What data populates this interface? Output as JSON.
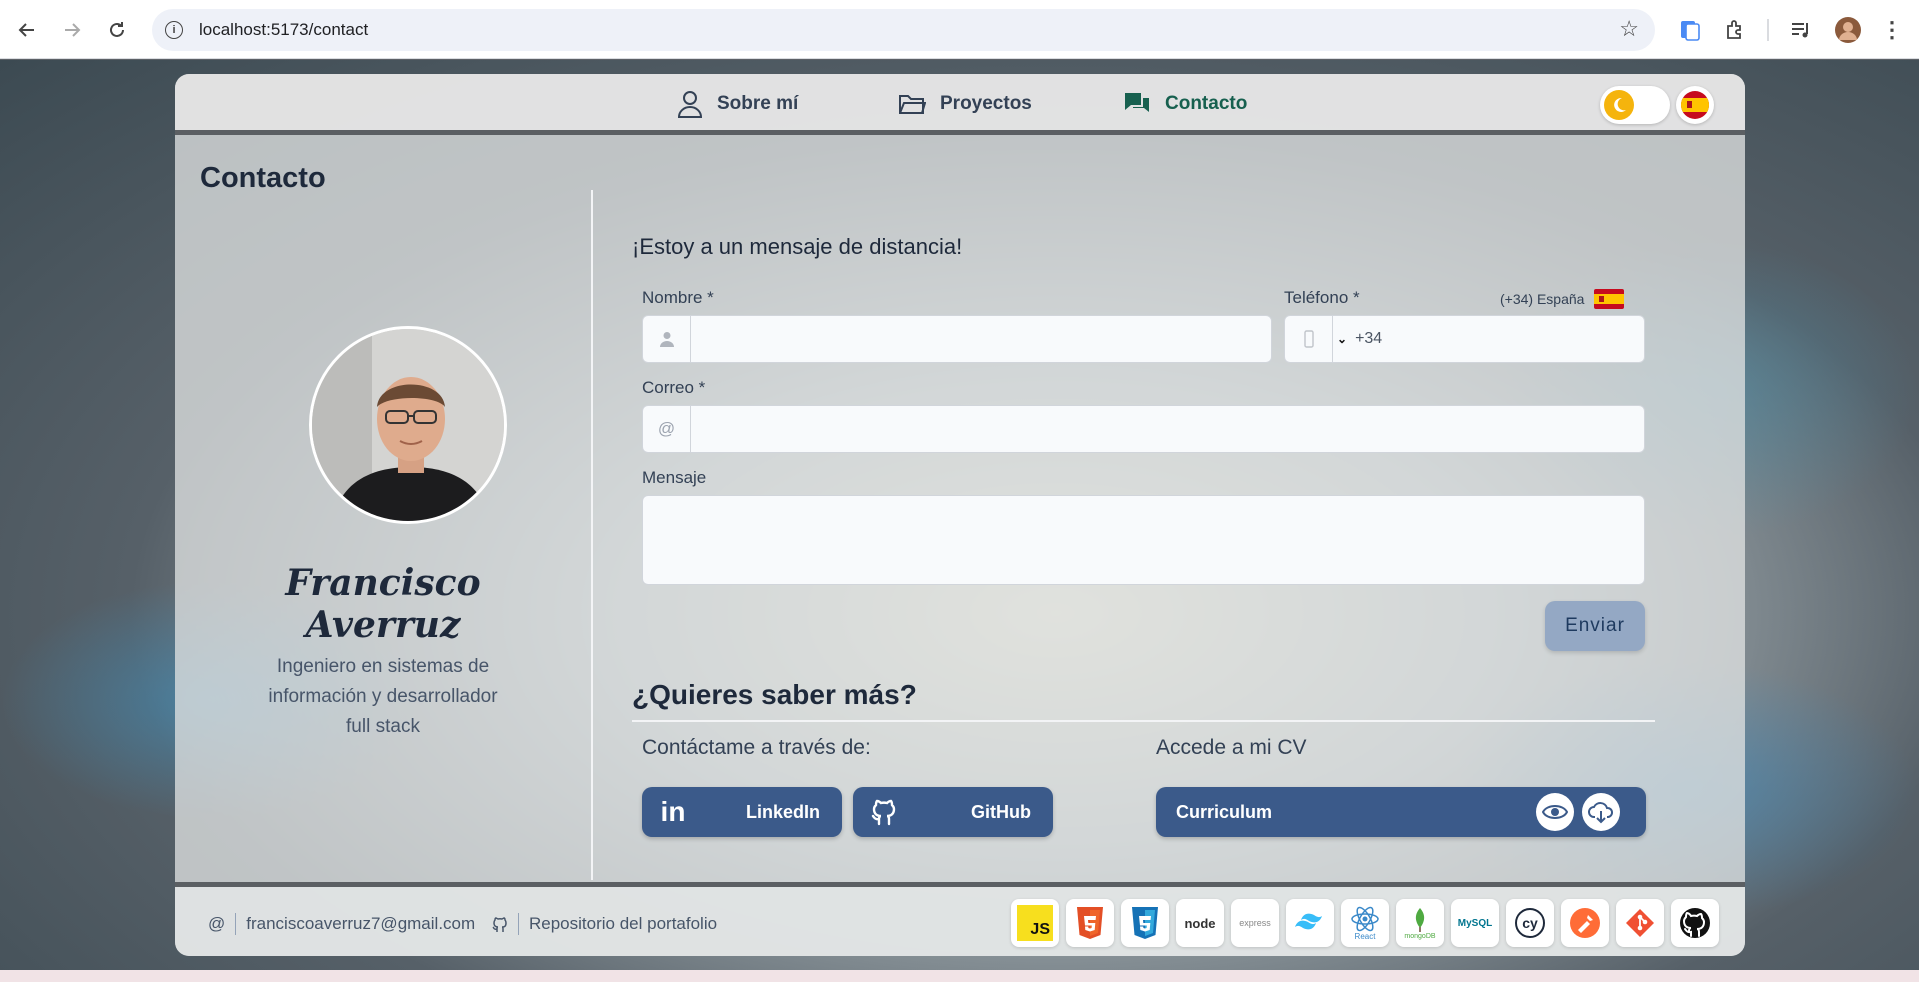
{
  "browser": {
    "url": "localhost:5173/contact"
  },
  "nav": {
    "items": [
      {
        "label": "Sobre mí",
        "icon": "user-icon"
      },
      {
        "label": "Proyectos",
        "icon": "folder-icon"
      },
      {
        "label": "Contacto",
        "icon": "chat-icon",
        "active": true
      }
    ],
    "theme_toggle": "moon-icon",
    "language": "spain-flag-icon"
  },
  "page": {
    "title": "Contacto"
  },
  "profile": {
    "name": "Francisco Averruz",
    "role": "Ingeniero en sistemas de información y desarrollador full stack"
  },
  "form": {
    "heading": "¡Estoy a un mensaje de distancia!",
    "name_label": "Nombre *",
    "name_value": "",
    "phone_label": "Teléfono *",
    "phone_country": "(+34) España",
    "phone_code": "+34",
    "email_label": "Correo *",
    "email_prefix": "@",
    "email_value": "",
    "message_label": "Mensaje",
    "message_value": "",
    "send_label": "Enviar"
  },
  "more": {
    "title": "¿Quieres saber más?",
    "contact_title": "Contáctame a través de:",
    "linkedin_icon_text": "in",
    "linkedin_label": "LinkedIn",
    "github_label": "GitHub",
    "cv_title": "Accede a mi CV",
    "cv_label": "Curriculum"
  },
  "footer": {
    "email_prefix": "@",
    "email": "franciscoaverruz7@gmail.com",
    "repo_label": "Repositorio del portafolio",
    "tech_badges": [
      {
        "name": "js",
        "text": "JS"
      },
      {
        "name": "html5",
        "text": "HTML"
      },
      {
        "name": "css3",
        "text": "CSS"
      },
      {
        "name": "node",
        "text": "node"
      },
      {
        "name": "express",
        "text": "express"
      },
      {
        "name": "tailwind",
        "text": ""
      },
      {
        "name": "react",
        "text": "React"
      },
      {
        "name": "mongodb",
        "text": "mongoDB"
      },
      {
        "name": "mysql",
        "text": "MySQL"
      },
      {
        "name": "cypress",
        "text": "cy"
      },
      {
        "name": "postman",
        "text": ""
      },
      {
        "name": "git",
        "text": ""
      },
      {
        "name": "github",
        "text": ""
      }
    ]
  },
  "colors": {
    "accent": "#3b5a8a",
    "active_nav": "#17604f",
    "send_button": "#94a8c4"
  }
}
